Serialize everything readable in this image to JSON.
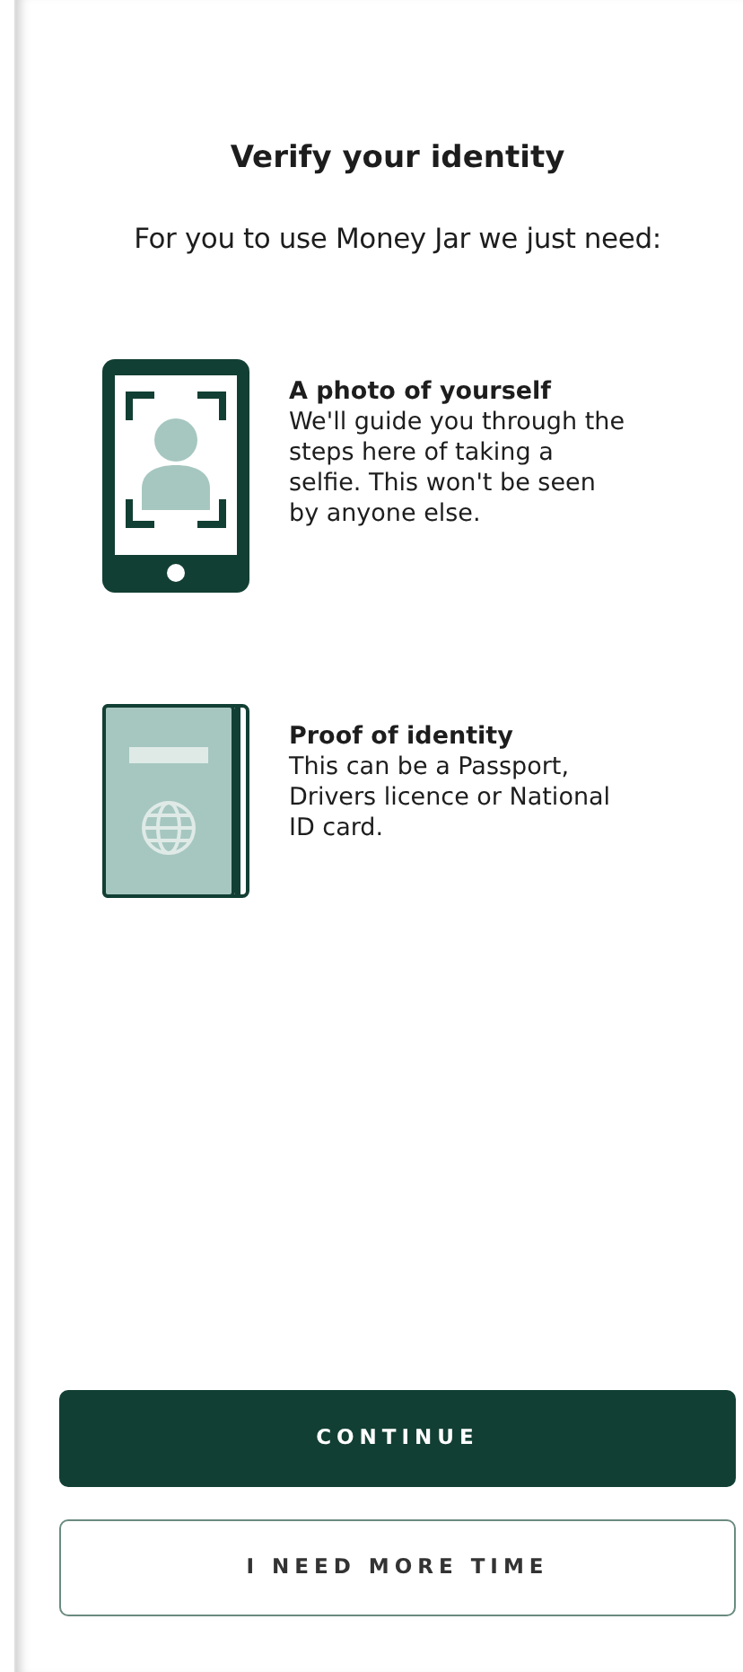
{
  "title": "Verify your identity",
  "intro": "For you to use Money Jar we just need:",
  "requirements": [
    {
      "kind": "selfie",
      "heading": "A photo of yourself",
      "text": "We'll guide you through the steps here of taking a selfie. This won't be seen by anyone else."
    },
    {
      "kind": "document",
      "heading": "Proof of identity",
      "text": "This can be a Passport, Drivers licence or National ID card."
    }
  ],
  "buttons": [
    {
      "kind": "primary",
      "label": "CONTINUE"
    },
    {
      "kind": "secondary",
      "label": "I NEED MORE TIME"
    }
  ]
}
